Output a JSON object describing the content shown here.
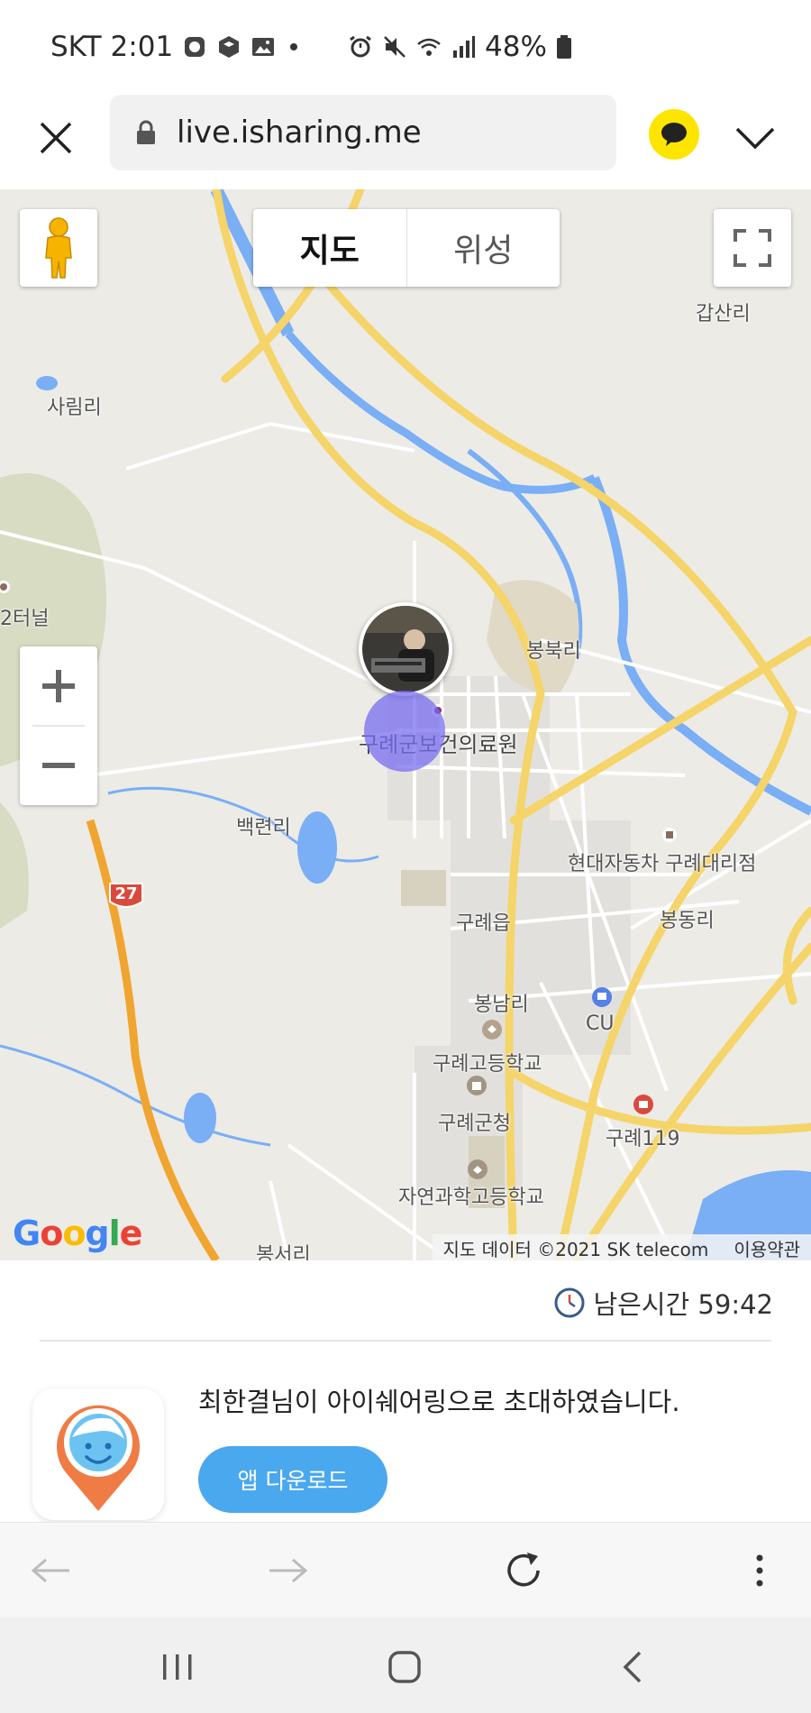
{
  "status_bar": {
    "carrier": "SKT",
    "time": "2:01",
    "battery": "48%"
  },
  "browser": {
    "url": "live.isharing.me"
  },
  "map": {
    "type_tabs": [
      "지도",
      "위성"
    ],
    "selected_tab": "지도",
    "labels": {
      "gapsanri": "갑산리",
      "sarimri": "사림리",
      "tunnel": "2터널",
      "bongbukri": "봉북리",
      "health_center": "구례군보건의료원",
      "baekryeonri": "백련리",
      "hyundai": "현대자동차 구례대리점",
      "guryeeup": "구례읍",
      "bongdongri": "봉동리",
      "bongnamri": "봉남리",
      "cu": "CU",
      "high_school": "구례고등학교",
      "county_office": "구례군청",
      "fire_station": "구례119",
      "science_hs": "자연과학고등학교",
      "bongseori": "봉서리",
      "route": "27"
    },
    "google": "Google",
    "attribution": "지도 데이터 ©2021 SK telecom",
    "terms": "이용약관"
  },
  "timer": {
    "label": "남은시간 59:42"
  },
  "invite": {
    "message": "최한결님이 아이쉐어링으로 초대하였습니다.",
    "download_label": "앱 다운로드"
  },
  "colors": {
    "road_major": "#f5d469",
    "road_highway": "#f0a530",
    "water": "#7aaef5",
    "map_bg": "#ecebe6",
    "download_button": "#4aa8ee",
    "kakao": "#fee500",
    "location_circle": "#786ef0"
  }
}
